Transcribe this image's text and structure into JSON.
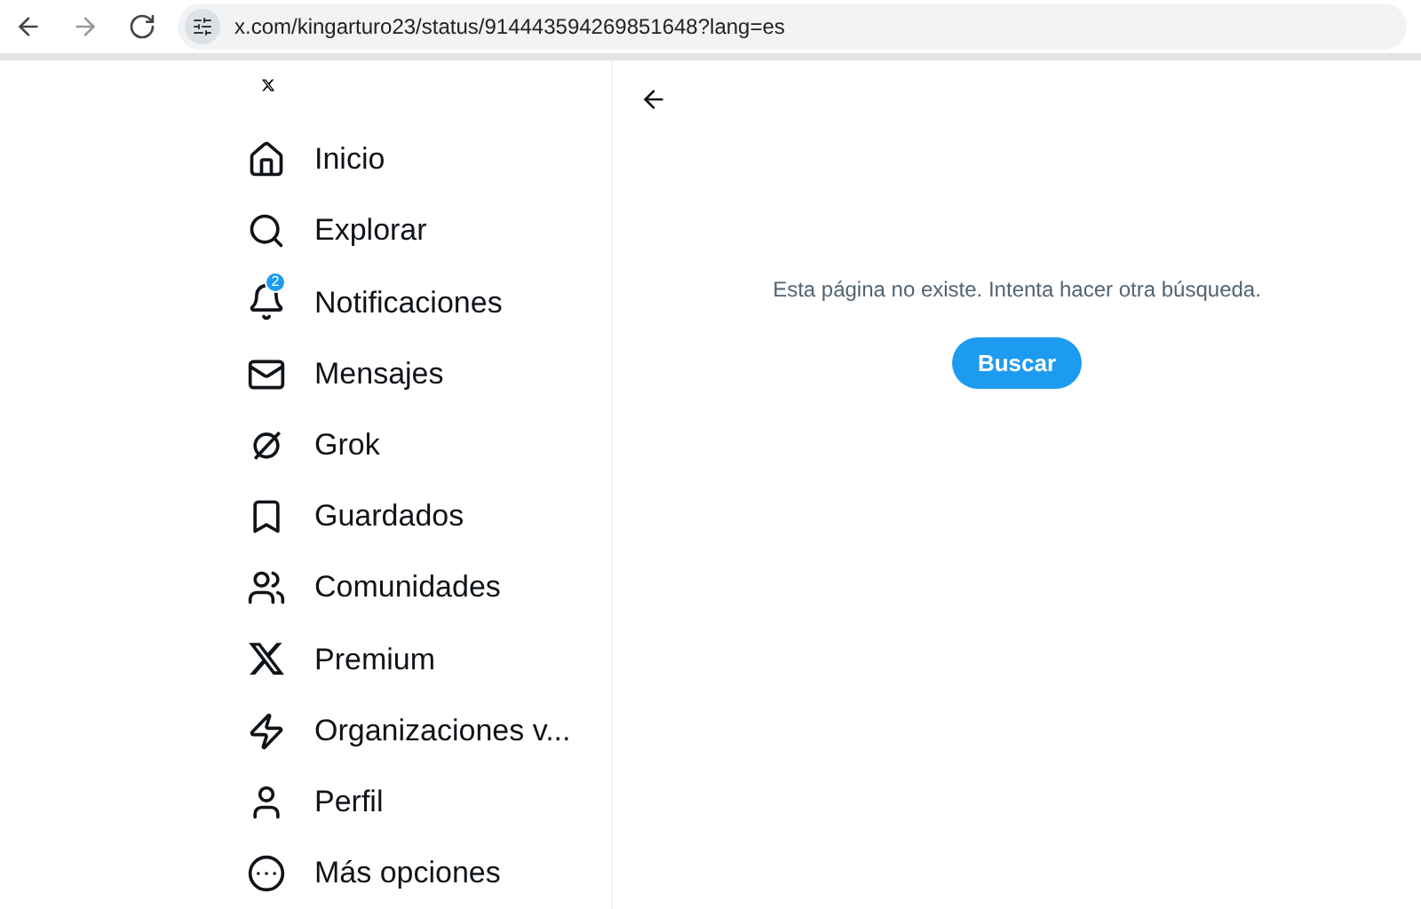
{
  "browser": {
    "url": "x.com/kingarturo23/status/914443594269851648?lang=es"
  },
  "sidebar": {
    "items": [
      {
        "label": "Inicio"
      },
      {
        "label": "Explorar"
      },
      {
        "label": "Notificaciones",
        "badge": "2"
      },
      {
        "label": "Mensajes"
      },
      {
        "label": "Grok"
      },
      {
        "label": "Guardados"
      },
      {
        "label": "Comunidades"
      },
      {
        "label": "Premium"
      },
      {
        "label": "Organizaciones v..."
      },
      {
        "label": "Perfil"
      },
      {
        "label": "Más opciones"
      }
    ]
  },
  "main": {
    "message": "Esta página no existe. Intenta hacer otra búsqueda.",
    "button": "Buscar"
  }
}
